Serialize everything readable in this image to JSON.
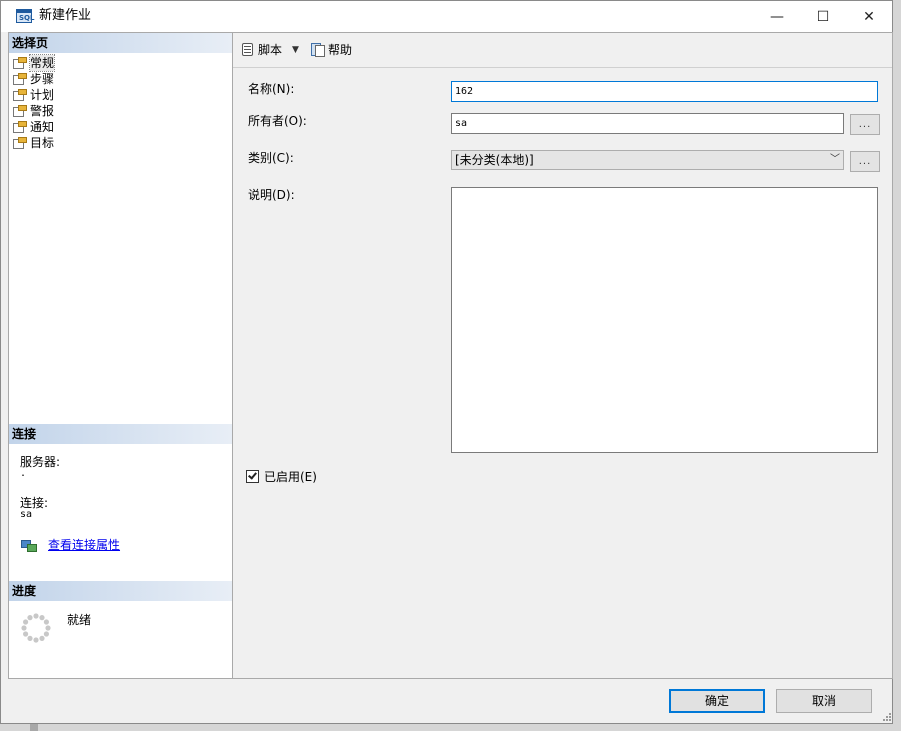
{
  "window": {
    "title": "新建作业",
    "controls": {
      "minimize": "—",
      "maximize": "☐",
      "close": "✕"
    }
  },
  "select_page": {
    "header": "选择页",
    "items": [
      {
        "label": "常规",
        "icon": "page-icon",
        "selected": true
      },
      {
        "label": "步骤",
        "icon": "page-icon"
      },
      {
        "label": "计划",
        "icon": "page-icon"
      },
      {
        "label": "警报",
        "icon": "page-icon"
      },
      {
        "label": "通知",
        "icon": "page-icon"
      },
      {
        "label": "目标",
        "icon": "page-icon"
      }
    ]
  },
  "connection": {
    "header": "连接",
    "server_label": "服务器:",
    "server_value": ".",
    "connection_label": "连接:",
    "connection_value": "sa",
    "view_properties_link": "查看连接属性"
  },
  "progress": {
    "header": "进度",
    "status": "就绪"
  },
  "toolbar": {
    "script_label": "脚本",
    "help_label": "帮助"
  },
  "form": {
    "name_label": "名称(N):",
    "name_value": "162",
    "owner_label": "所有者(O):",
    "owner_value": "sa",
    "category_label": "类别(C):",
    "category_value": "[未分类(本地)]",
    "description_label": "说明(D):",
    "description_value": "",
    "browse_label": "...",
    "enabled_label": "已启用(E)",
    "enabled_checked": true
  },
  "buttons": {
    "ok": "确定",
    "cancel": "取消"
  },
  "colors": {
    "accent": "#0078d7",
    "link": "#0000ee",
    "header_gradient_start": "#c2d4ea"
  }
}
